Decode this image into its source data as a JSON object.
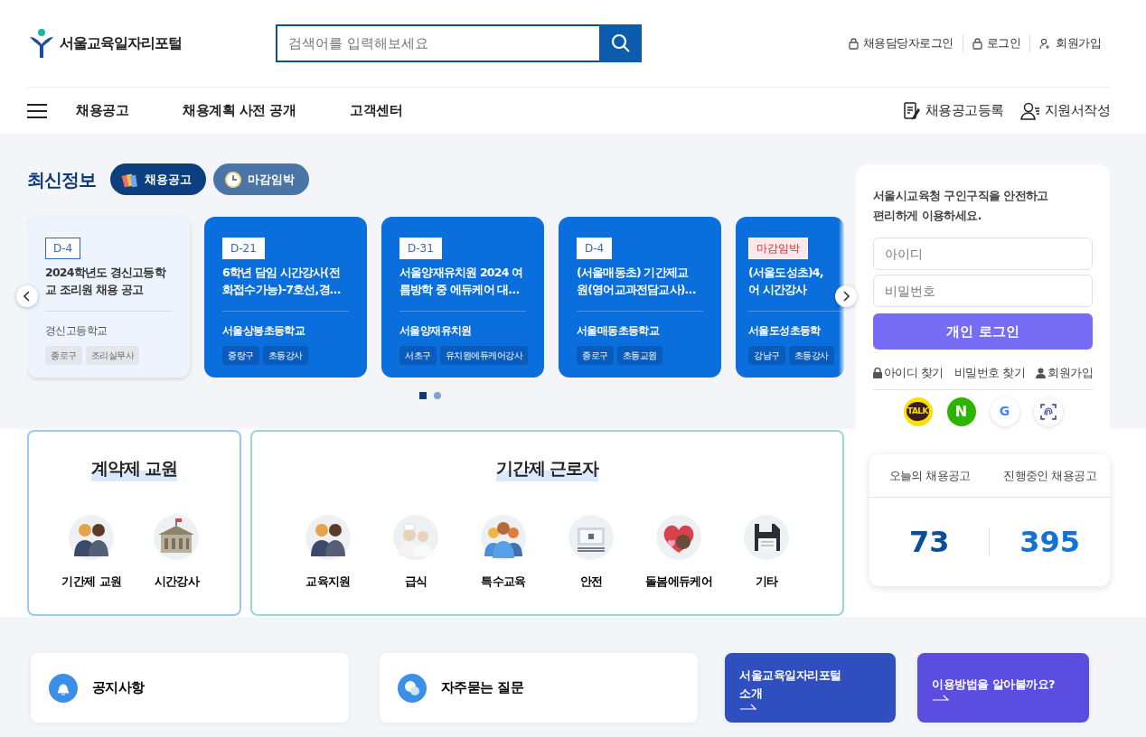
{
  "header": {
    "logo_text": "서울교육일자리포털",
    "search": {
      "placeholder": "검색어를 입력해보세요"
    },
    "top_links": [
      {
        "kind": "lock",
        "label": "채용담당자로그인"
      },
      {
        "kind": "lock",
        "label": "로그인"
      },
      {
        "kind": "user-plus",
        "label": "회원가입"
      }
    ]
  },
  "nav": {
    "items": [
      "채용공고",
      "채용계획 사전 공개",
      "고객센터"
    ],
    "right_links": [
      {
        "kind": "doc",
        "label": "채용공고등록"
      },
      {
        "kind": "person",
        "label": "지원서작성"
      }
    ]
  },
  "latest": {
    "title": "최신정보",
    "tabs": [
      {
        "kind": "books",
        "label": "채용공고",
        "selected": true
      },
      {
        "kind": "clock",
        "label": "마감임박",
        "selected": false
      }
    ],
    "cards": [
      {
        "badge": {
          "kind": "dday",
          "text": "D-4"
        },
        "highlighted": true,
        "partial": false,
        "title_lines": [
          "2024학년도 경신고등학",
          "교 조리원 채용 공고"
        ],
        "school": "경신고등학교",
        "tags": [
          "종로구",
          "조리실무사"
        ]
      },
      {
        "badge": {
          "kind": "dday",
          "text": "D-21"
        },
        "highlighted": false,
        "partial": false,
        "title_lines": [
          "6학년 담임 시간강사(전",
          "화접수가능)-7호선,경…"
        ],
        "school": "서울상봉초등학교",
        "tags": [
          "중랑구",
          "초등강사"
        ]
      },
      {
        "badge": {
          "kind": "dday",
          "text": "D-31"
        },
        "highlighted": false,
        "partial": false,
        "title_lines": [
          "서울양재유치원 2024 여",
          "름방학 중 에듀케어 대…"
        ],
        "school": "서울양재유치원",
        "tags": [
          "서초구",
          "유치원에듀케어강사"
        ]
      },
      {
        "badge": {
          "kind": "dday",
          "text": "D-4"
        },
        "highlighted": false,
        "partial": false,
        "title_lines": [
          "(서울매동초) 기간제교",
          "원(영어교과전담교사)…"
        ],
        "school": "서울매동초등학교",
        "tags": [
          "종로구",
          "초등교원"
        ]
      },
      {
        "badge": {
          "kind": "urgent",
          "text": "마감임박"
        },
        "highlighted": false,
        "partial": true,
        "title_lines": [
          "(서울도성초)4,",
          "어 시간강사"
        ],
        "school": "서울도성초등학",
        "tags": [
          "강남구",
          "초등강사"
        ]
      }
    ],
    "pages": [
      {
        "selected": true
      },
      {
        "selected": false
      }
    ]
  },
  "login": {
    "intro_lines": [
      "서울시교육청 구인구직을 안전하고",
      "편리하게 이용하세요."
    ],
    "id_field": {
      "placeholder": "아이디"
    },
    "pw_field": {
      "placeholder": "비밀번호"
    },
    "button": "개인 로그인",
    "links": [
      {
        "kind": "lock",
        "label": "아이디 찾기"
      },
      {
        "kind": "none",
        "label": "비밀번호 찾기"
      },
      {
        "kind": "person",
        "label": "회원가입"
      }
    ],
    "social": [
      {
        "kind": "kakao",
        "label": "TALK"
      },
      {
        "kind": "naver",
        "label": "N"
      },
      {
        "kind": "google",
        "label": "G"
      },
      {
        "kind": "fingerprint"
      }
    ]
  },
  "categories": [
    {
      "title": "계약제 교원",
      "kind": "contract",
      "items": [
        {
          "kind": "couple",
          "label": "기간제 교원"
        },
        {
          "kind": "building",
          "label": "시간강사"
        }
      ]
    },
    {
      "title": "기간제 근로자",
      "kind": "temp",
      "items": [
        {
          "kind": "couple",
          "label": "교육지원"
        },
        {
          "kind": "chefs",
          "label": "급식"
        },
        {
          "kind": "group",
          "label": "특수교육"
        },
        {
          "kind": "monitor",
          "label": "안전"
        },
        {
          "kind": "heart",
          "label": "돌봄에듀케어"
        },
        {
          "kind": "disk",
          "label": "기타"
        }
      ]
    }
  ],
  "stats": [
    {
      "label": "오늘의 채용공고",
      "value": "73",
      "color": "#0b4f9c"
    },
    {
      "label": "진행중인 채용공고",
      "value": "395",
      "color": "#1273d6"
    }
  ],
  "quick_links": [
    {
      "kind": "bell",
      "label": "공지사항"
    },
    {
      "kind": "chat",
      "label": "자주묻는 질문"
    },
    {
      "kind": "banner",
      "color": "#2f4fbf",
      "lines": [
        "서울교육일자리포털",
        "소개"
      ]
    },
    {
      "kind": "banner",
      "color": "#5a4de0",
      "lines": [
        "이용방법을 알아볼까요?"
      ]
    }
  ]
}
